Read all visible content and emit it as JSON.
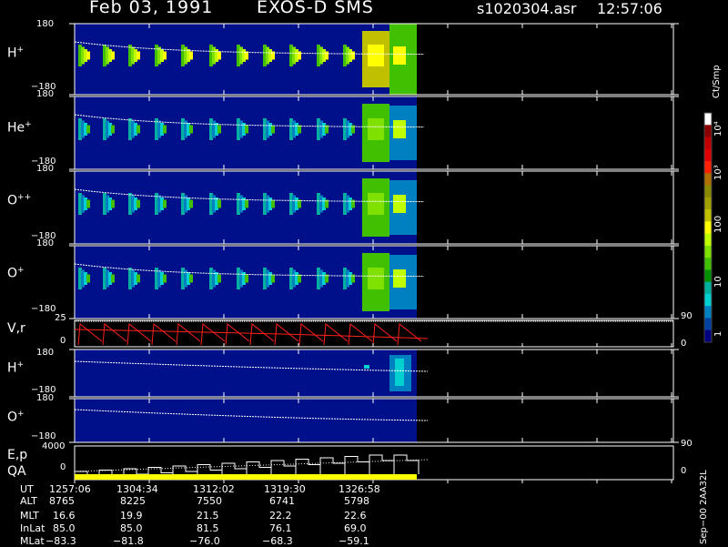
{
  "header": {
    "date": "Feb 03, 1991",
    "mission": "EXOS-D SMS",
    "file": "s1020304.asr",
    "time": "12:57:06"
  },
  "panels": [
    {
      "label": "H",
      "sup": "+",
      "ymax": "180",
      "ymin": "−180"
    },
    {
      "label": "He",
      "sup": "+",
      "ymax": "180",
      "ymin": "−180"
    },
    {
      "label": "O",
      "sup": "++",
      "ymax": "180",
      "ymin": "−180"
    },
    {
      "label": "O",
      "sup": "+",
      "ymax": "180",
      "ymin": "−180"
    }
  ],
  "vr_panel": {
    "label": "V,r",
    "ymax": "25",
    "ymin": "0",
    "right_top": "90",
    "right_bottom": "0"
  },
  "h_panel2": {
    "label": "H",
    "sup": "+",
    "ymax": "180",
    "ymin": "−180"
  },
  "o_panel2": {
    "label": "O",
    "sup": "+",
    "ymax": "180",
    "ymin": "−180"
  },
  "ep_panel": {
    "label1": "E,p",
    "label2": "QA",
    "ymax": "4000",
    "ymin": "0",
    "right_top": "90",
    "right_bottom": "0"
  },
  "colorbar": {
    "title": "Ct/Smp",
    "ticks": [
      "10⁴",
      "10³",
      "100",
      "10",
      "1"
    ],
    "colors": [
      "#ffffff",
      "#8b0000",
      "#c00000",
      "#e00000",
      "#ff2000",
      "#b07000",
      "#8a8a00",
      "#a0a000",
      "#c0c000",
      "#ffff00",
      "#c0ff00",
      "#80e000",
      "#40c000",
      "#009000",
      "#00b0a0",
      "#00d0d0",
      "#0080c0",
      "#0040a0",
      "#000080"
    ]
  },
  "footer": {
    "row_labels": [
      "UT",
      "ALT",
      "MLT",
      "InLat",
      "MLat"
    ],
    "columns": [
      [
        "1257:06",
        "8765",
        "16.6",
        "85.0",
        "−83.3"
      ],
      [
        "1304:34",
        "8225",
        "19.9",
        "85.0",
        "−81.8"
      ],
      [
        "1312:02",
        "7550",
        "21.5",
        "81.5",
        "−76.0"
      ],
      [
        "1319:30",
        "6741",
        "22.2",
        "76.1",
        "−68.3"
      ],
      [
        "1326:58",
        "5798",
        "22.6",
        "69.0",
        "−59.1"
      ]
    ]
  },
  "stamp": "Sep−00 2AA32L",
  "chart_data": {
    "type": "heatmap",
    "x_ticks": [
      "1257:06",
      "1304:34",
      "1312:02",
      "1319:30",
      "1326:58"
    ],
    "panels": [
      "H+",
      "He+",
      "O++",
      "O+",
      "V,r",
      "H+",
      "O+",
      "E,p QA"
    ],
    "pitch_angle_range": [
      -180,
      180
    ],
    "colorbar_units": "Ct/Smp",
    "colorbar_range": [
      1,
      10000
    ],
    "colorbar_scale": "log"
  }
}
